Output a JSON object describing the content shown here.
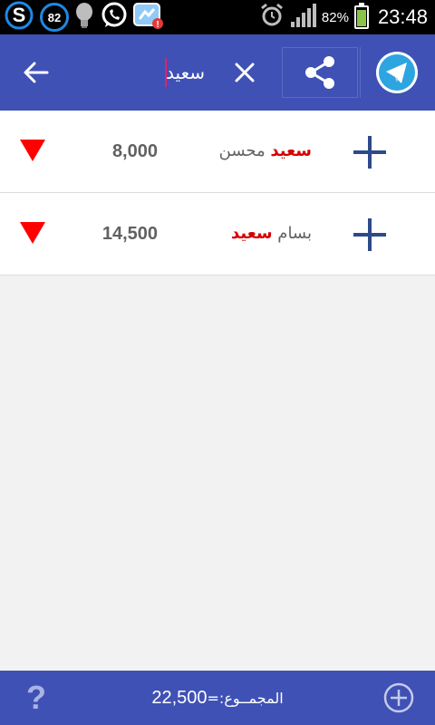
{
  "status_bar": {
    "notif_count": "82",
    "battery_percent": "82%",
    "battery_level": 0.82,
    "time": "23:48",
    "left_icons": [
      "skype-icon",
      "notification-count-badge",
      "bulb-icon",
      "whatsapp-icon",
      "messenger-alert-icon"
    ],
    "right_icons": [
      "alarm-icon",
      "signal-icon",
      "battery-icon"
    ]
  },
  "toolbar": {
    "search_value": "سعيد",
    "icons": [
      "back-arrow-icon",
      "clear-icon",
      "share-icon",
      "telegram-icon"
    ]
  },
  "list": {
    "items": [
      {
        "amount": "8,000",
        "highlight": "سعيد",
        "rest": "محسن",
        "highlight_first": true
      },
      {
        "amount": "14,500",
        "highlight": "سعيد",
        "rest": "بسام",
        "highlight_first": false
      }
    ]
  },
  "footer": {
    "help_label": "?",
    "total_label": "المجمــوع:=",
    "total_value": "22,500"
  },
  "colors": {
    "primary": "#3f51b5",
    "highlight": "#d50000",
    "arrow": "#ff0000",
    "plus": "#2e4a8a",
    "telegram": "#2ca5e0",
    "battery": "#8bc34a"
  }
}
